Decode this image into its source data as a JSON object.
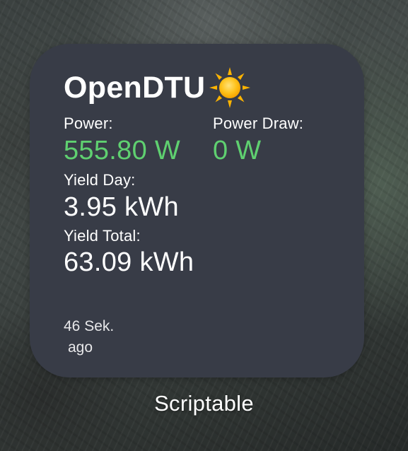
{
  "widget": {
    "title": "OpenDTU",
    "title_icon": "sun-icon",
    "power": {
      "label": "Power:",
      "value": "555.80 W"
    },
    "power_draw": {
      "label": "Power Draw:",
      "value": "0 W"
    },
    "yield_day": {
      "label": "Yield Day:",
      "value": "3.95 kWh"
    },
    "yield_total": {
      "label": "Yield Total:",
      "value": "63.09 kWh"
    },
    "updated": {
      "line1": "46 Sek.",
      "line2": "ago"
    }
  },
  "app_label": "Scriptable",
  "colors": {
    "widget_background": "#383c47",
    "positive_value": "#5fd070",
    "text": "#ffffff"
  }
}
